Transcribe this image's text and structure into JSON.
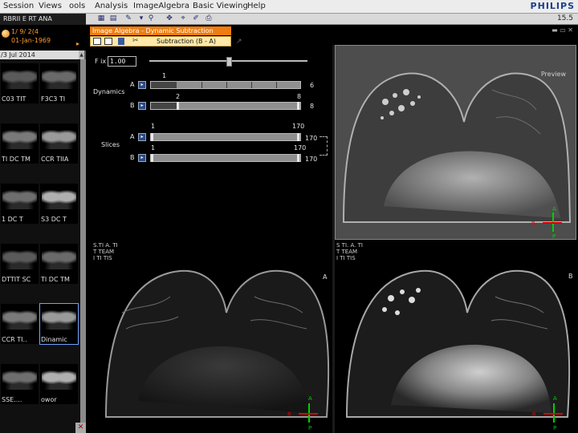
{
  "menu": {
    "items": [
      "Session",
      "Views",
      "ools",
      "Analysis",
      "ImageAlgebra",
      "Basic Viewing",
      "Help"
    ],
    "brand": "PHILIPS"
  },
  "toolbar": {
    "right_text": "15.5"
  },
  "patient": {
    "name": "RBRII   E RT   ANA",
    "study_date": "1/ 9/ 2(4",
    "birth_date": "01-Jan-1969",
    "expand_glyph": "▸"
  },
  "thumbnails": {
    "date_header": "/3  Jul 2014",
    "items": [
      {
        "label": "C03 TIT"
      },
      {
        "label": "F3C3  TI"
      },
      {
        "label": "TI DC TM"
      },
      {
        "label": "CCR TIIA"
      },
      {
        "label": "1  DC  T"
      },
      {
        "label": "S3  DC T"
      },
      {
        "label": "DTTIT SC"
      },
      {
        "label": "TI DC TM"
      },
      {
        "label": "CCR TI.."
      },
      {
        "label": "Dinamic"
      },
      {
        "label": "SSE...."
      },
      {
        "label": "owor"
      }
    ]
  },
  "tool_window": {
    "title": "Image Algebra -  Dynamic Subtraction",
    "tab_label": "Subtraction  (B - A)",
    "window_controls": "▬  ▭  ✕"
  },
  "controls": {
    "factor_label": "F ix",
    "factor_value": "1.00",
    "dynamics": {
      "label": "Dynamics",
      "a_label": "A",
      "b_label": "B",
      "a_value": "1",
      "a_max": "6",
      "b_value": "2",
      "b_current": "8",
      "b_max": "8"
    },
    "slices": {
      "label": "Slices",
      "a_label": "A",
      "b_label": "B",
      "a_start": "1",
      "a_end": "170",
      "a_max": "170",
      "b_start": "1",
      "b_end": "170",
      "b_max": "170"
    }
  },
  "viewports": {
    "preview": {
      "label": "Preview",
      "orient_top": "A",
      "orient_right": "R",
      "orient_bottom": "P"
    },
    "a": {
      "info_lines": [
        "S.TI  A. TI",
        "T  TEAM",
        "I TI  TIS"
      ],
      "letter": "A",
      "orient_top": "A",
      "orient_right": "R",
      "orient_bottom": "P"
    },
    "b": {
      "info_lines": [
        "S  TI.  A. TI",
        "T  TEAM",
        "I  TI  TIS"
      ],
      "letter": "B",
      "orient_top": "A",
      "orient_right": "R",
      "orient_bottom": "P"
    }
  },
  "colors": {
    "accent_orange": "#ef7d0f",
    "patient_text": "#ff9c2a",
    "marker_green": "#00d000",
    "marker_red": "#e00000"
  }
}
